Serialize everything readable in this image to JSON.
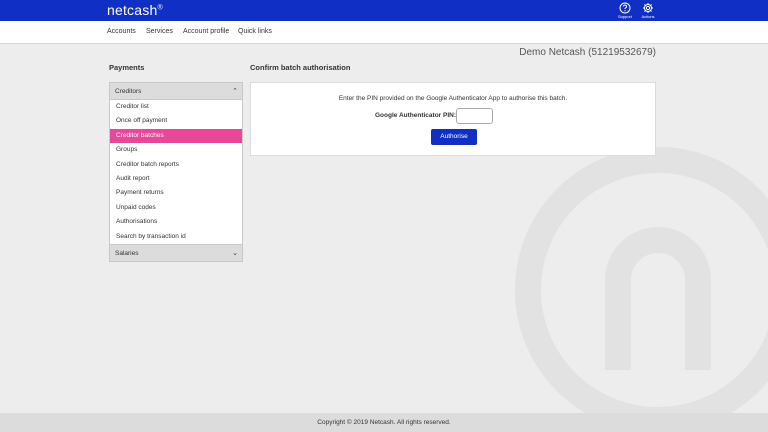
{
  "brand": {
    "logo_text": "netcash",
    "logo_mark": "®"
  },
  "top_actions": [
    {
      "label": "Support",
      "icon": "question-circle-icon"
    },
    {
      "label": "Actions",
      "icon": "gear-icon"
    }
  ],
  "nav": [
    "Accounts",
    "Services",
    "Account profile",
    "Quick links"
  ],
  "account_name": "Demo Netcash (51219532679)",
  "sidebar": {
    "title": "Payments",
    "section_open": "Creditors",
    "items": [
      {
        "label": "Creditor list",
        "active": false
      },
      {
        "label": "Once off payment",
        "active": false
      },
      {
        "label": "Creditor batches",
        "active": true
      },
      {
        "label": "Groups",
        "active": false
      },
      {
        "label": "Creditor batch reports",
        "active": false
      },
      {
        "label": "Audit report",
        "active": false
      },
      {
        "label": "Payment returns",
        "active": false
      },
      {
        "label": "Unpaid codes",
        "active": false
      },
      {
        "label": "Authorisations",
        "active": false
      },
      {
        "label": "Search by transaction id",
        "active": false
      }
    ],
    "section_closed": "Salaries"
  },
  "main": {
    "title": "Confirm batch authorisation",
    "instruction": "Enter the PIN provided on the Google Authenticator App to authorise this batch.",
    "pin_label": "Google Authenticator PIN:",
    "pin_value": "",
    "button_label": "Authorise"
  },
  "footer": "Copyright © 2019 Netcash. All rights reserved.",
  "colors": {
    "brand_blue": "#0f2fc5",
    "active_pink": "#e8479a"
  }
}
